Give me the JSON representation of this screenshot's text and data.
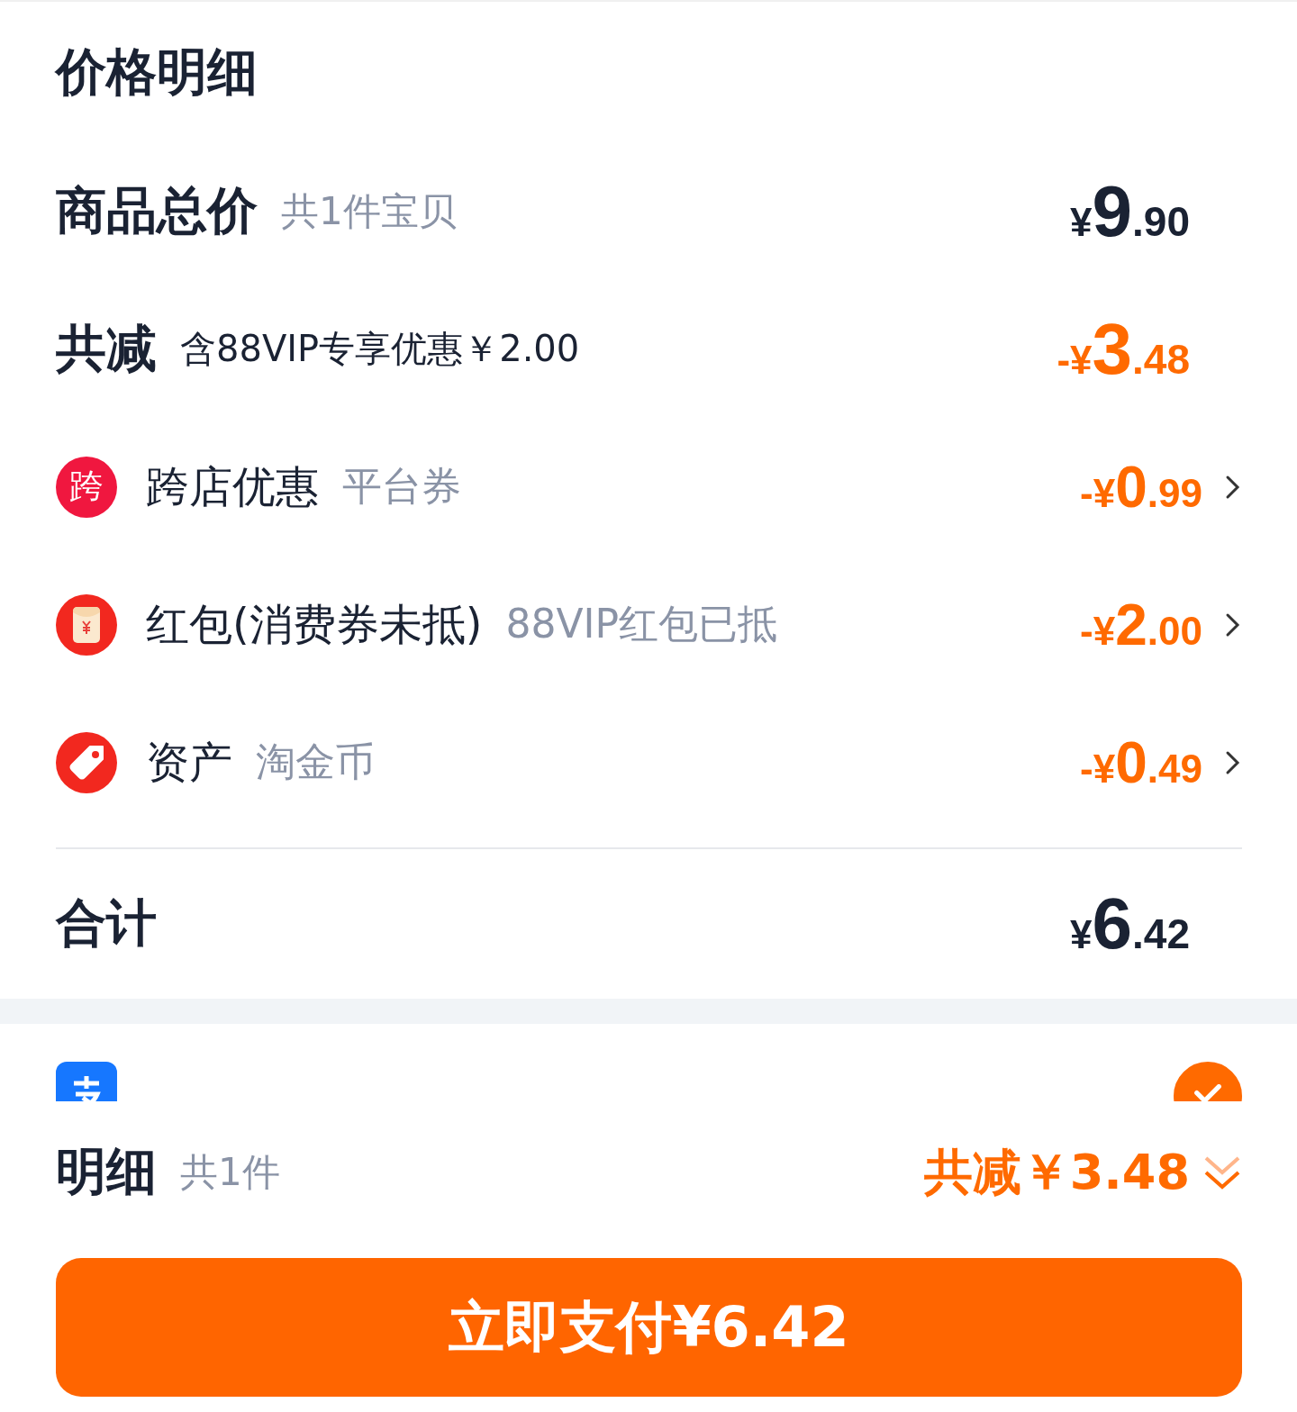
{
  "title": "价格明细",
  "summary_rows": [
    {
      "kind": "total",
      "label": "商品总价",
      "note": "共1件宝贝",
      "price": {
        "sign": "¥",
        "int": "9",
        "dec": ".90"
      },
      "accent": false
    },
    {
      "kind": "discount",
      "label": "共减",
      "note": "含88VIP专享优惠￥2.00",
      "price": {
        "sign": "-¥",
        "int": "3",
        "dec": ".48"
      },
      "accent": true
    }
  ],
  "items": [
    {
      "kind": "text-badge",
      "badge_text": "跨",
      "label": "跨店优惠",
      "note": "平台券",
      "price": {
        "sign": "-¥",
        "int": "0",
        "dec": ".99"
      }
    },
    {
      "kind": "red-envelope",
      "label": "红包(消费券未抵)",
      "note": "88VIP红包已抵",
      "price": {
        "sign": "-¥",
        "int": "2",
        "dec": ".00"
      }
    },
    {
      "kind": "tag",
      "label": "资产",
      "note": "淘金币",
      "price": {
        "sign": "-¥",
        "int": "0",
        "dec": ".49"
      }
    }
  ],
  "grand_total": {
    "label": "合计",
    "price": {
      "sign": "¥",
      "int": "6",
      "dec": ".42"
    }
  },
  "payment": {
    "selected": true
  },
  "footer": {
    "label": "明细",
    "count": "共1件",
    "savings": "共减￥3.48",
    "expanded": false
  },
  "pay_button": "立即支付¥6.42"
}
